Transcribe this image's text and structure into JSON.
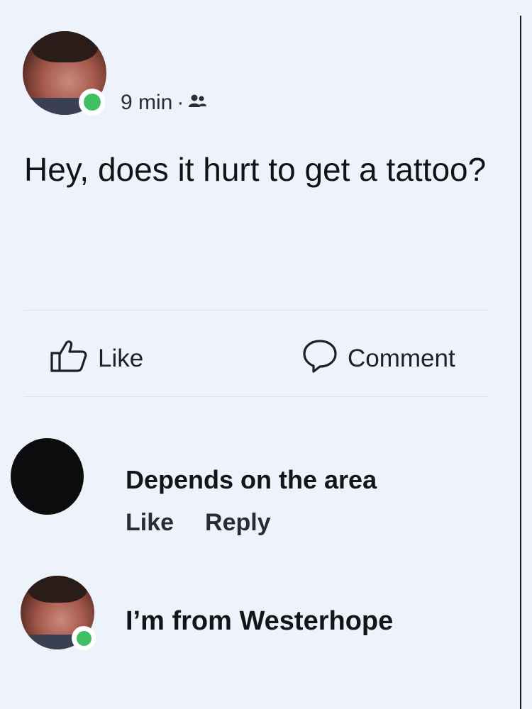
{
  "post": {
    "time": "9 min",
    "separator": "·",
    "audience_icon": "friends-icon",
    "text": "Hey, does it hurt to get a tattoo?"
  },
  "actions": {
    "like_label": "Like",
    "like_icon": "thumbs-up-icon",
    "comment_label": "Comment",
    "comment_icon": "speech-bubble-icon"
  },
  "comments": [
    {
      "text": "Depends on the area",
      "like_label": "Like",
      "reply_label": "Reply"
    },
    {
      "text": "I’m from Westerhope"
    }
  ],
  "colors": {
    "background": "#eef2fb",
    "online_green": "#3fbf62"
  }
}
